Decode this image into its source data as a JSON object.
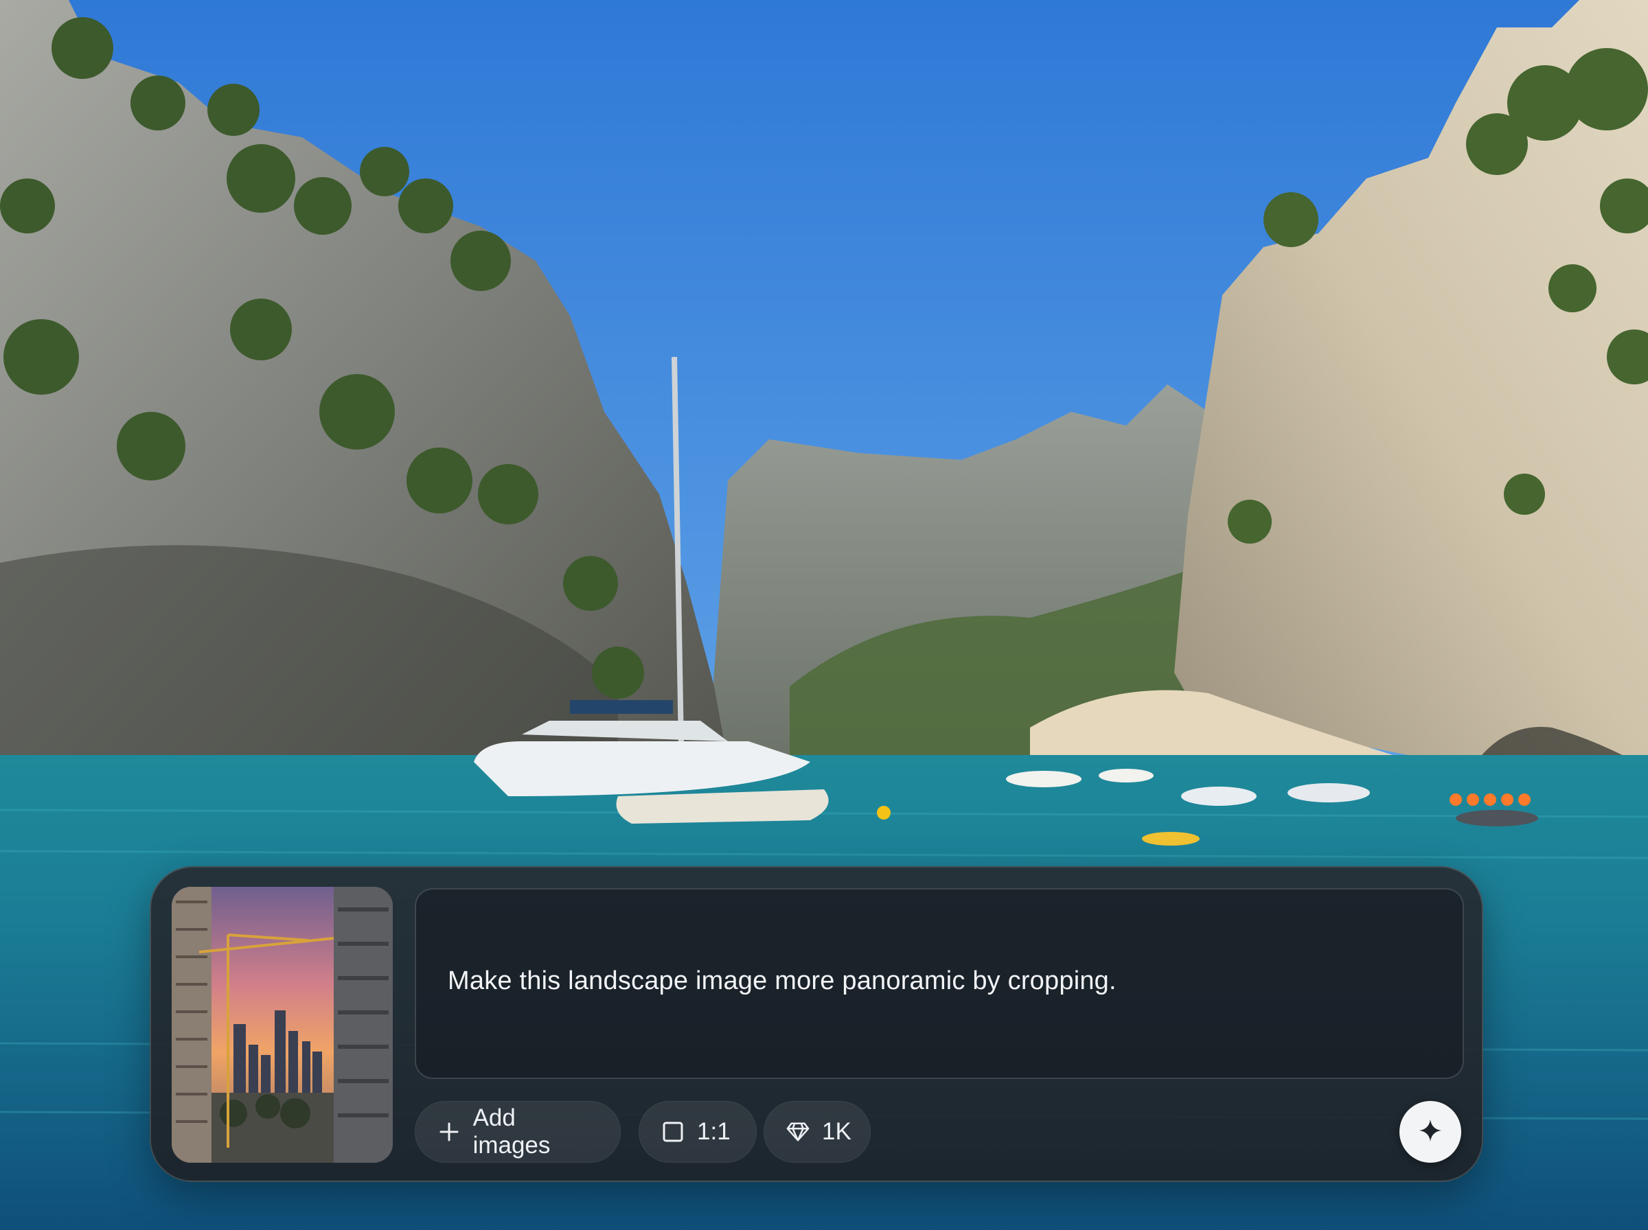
{
  "composer": {
    "prompt_text": "Make this landscape image more panoramic by cropping.",
    "add_images_label": "Add images",
    "aspect_ratio_label": "1:1",
    "resolution_label": "1K",
    "icons": {
      "add": "plus-icon",
      "aspect_ratio": "square-icon",
      "resolution": "diamond-icon",
      "send": "sparkle-icon"
    }
  },
  "colors": {
    "composer_bg": "#262c32",
    "send_button_bg": "#f3f4f5",
    "text": "#f2f4f6"
  }
}
